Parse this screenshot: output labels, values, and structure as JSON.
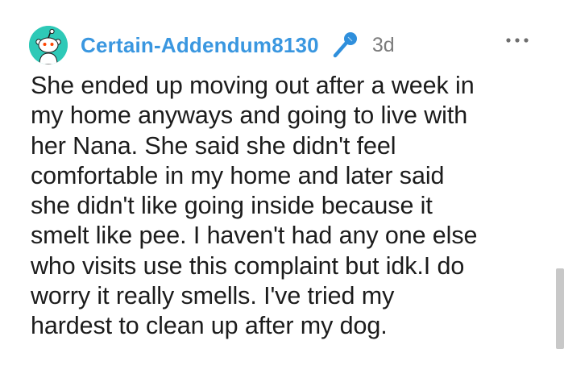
{
  "comment": {
    "username": "Certain-Addendum8130",
    "age": "3d",
    "avatar_icon": "reddit-snoo-avatar-icon",
    "badge_icon": "microphone-icon",
    "menu_icon": "more-options-icon",
    "body": "She ended up moving out after a week in\nmy home anyways and going to live with\nher Nana. She said she didn't feel\ncomfortable in my home and later said\nshe didn't like going inside because it\nsmelt like pee. I haven't had any one else\nwho visits use this complaint but idk.I do\nworry it really smells. I've tried my\nhardest to clean up after my dog."
  },
  "colors": {
    "avatar_bg": "#2ec9b7",
    "username": "#3a97e0",
    "mic": "#2f8fdc",
    "meta_text": "#7c7c7c",
    "body_text": "#1c1c1c"
  }
}
